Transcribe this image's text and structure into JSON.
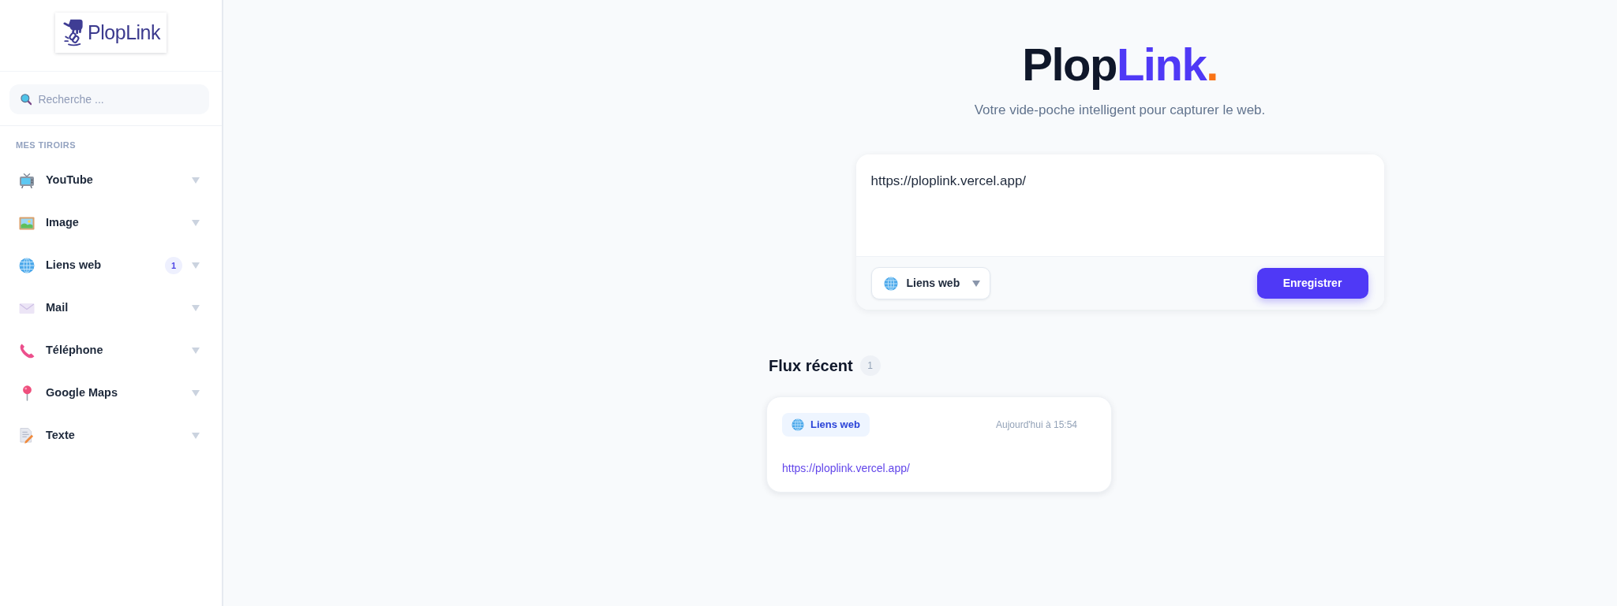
{
  "sidebar": {
    "logo": {
      "text": "PlopLink"
    },
    "search": {
      "placeholder": "Recherche ..."
    },
    "section_title": "MES TIROIRS",
    "items": [
      {
        "label": "YouTube"
      },
      {
        "label": "Image"
      },
      {
        "label": "Liens web",
        "count": "1"
      },
      {
        "label": "Mail"
      },
      {
        "label": "Téléphone"
      },
      {
        "label": "Google Maps"
      },
      {
        "label": "Texte"
      }
    ]
  },
  "hero": {
    "title": [
      "Plop",
      "Link",
      "."
    ],
    "subtitle": "Votre vide-poche intelligent pour capturer le web."
  },
  "composer": {
    "value": "https://ploplink.vercel.app/",
    "category": "Liens web",
    "submit": "Enregistrer"
  },
  "feed": {
    "title": "Flux récent",
    "count": "1",
    "items": [
      {
        "category": "Liens web",
        "time": "Aujourd'hui à 15:54",
        "url": "https://ploplink.vercel.app/"
      }
    ]
  }
}
